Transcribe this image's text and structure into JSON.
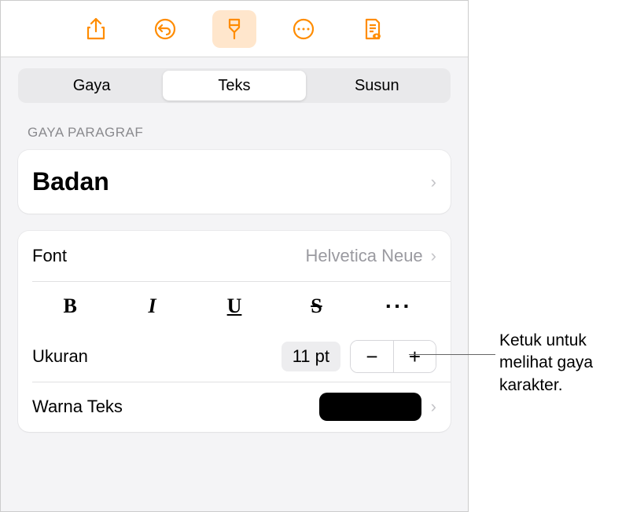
{
  "toolbar": {
    "share_icon": "share-icon",
    "undo_icon": "undo-icon",
    "format_icon": "format-brush-icon",
    "more_icon": "more-circle-icon",
    "document_icon": "document-view-icon"
  },
  "tabs": {
    "items": [
      "Gaya",
      "Teks",
      "Susun"
    ],
    "active": "Teks"
  },
  "paragraph": {
    "header": "GAYA PARAGRAF",
    "style_name": "Badan"
  },
  "font": {
    "label": "Font",
    "value": "Helvetica Neue"
  },
  "styles": {
    "bold": "B",
    "italic": "I",
    "underline": "U",
    "strike": "S",
    "more": "···"
  },
  "size": {
    "label": "Ukuran",
    "value": "11 pt",
    "minus": "−",
    "plus": "+"
  },
  "text_color": {
    "label": "Warna Teks",
    "value_hex": "#000000"
  },
  "callout": {
    "text": "Ketuk untuk melihat gaya karakter."
  }
}
